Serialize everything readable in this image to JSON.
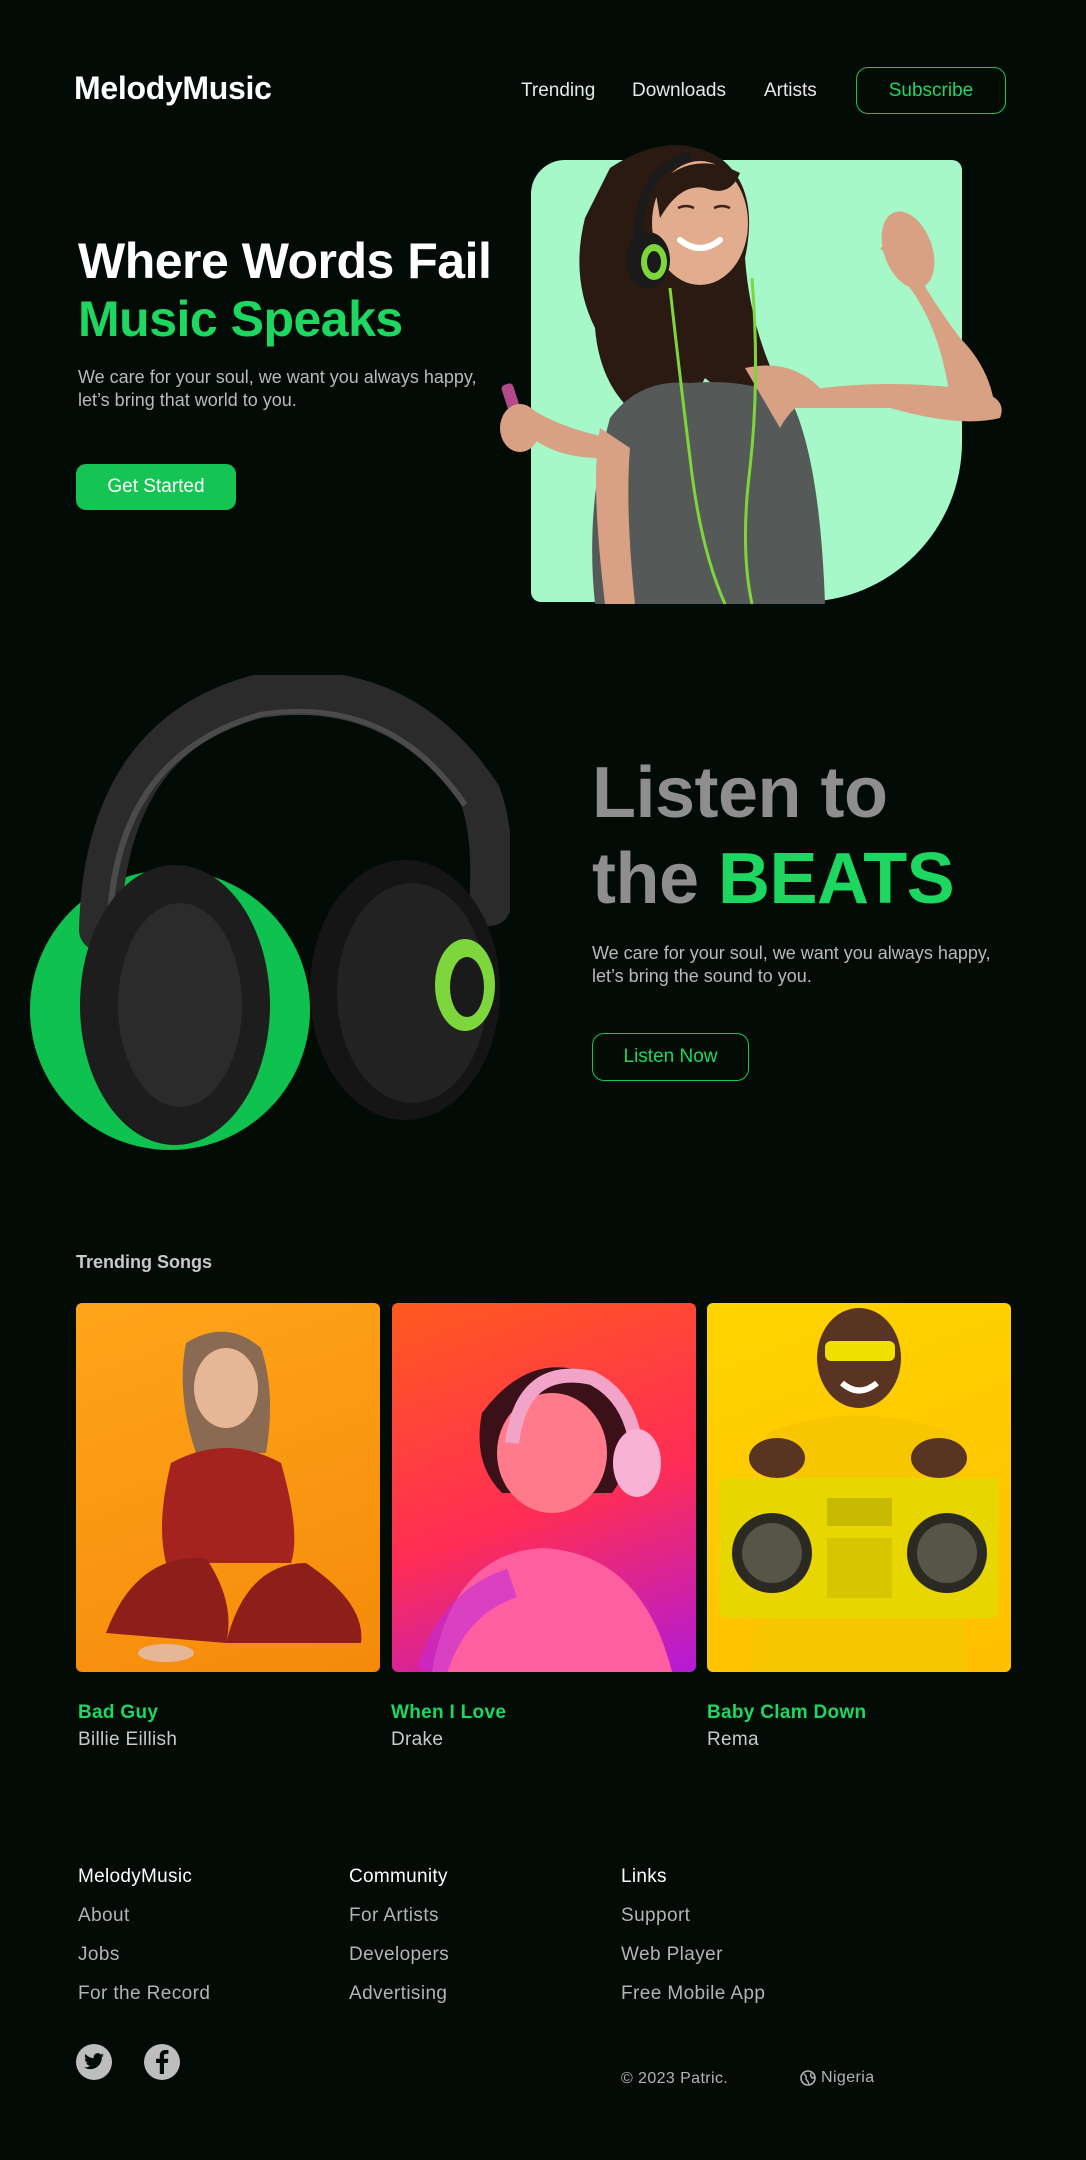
{
  "brand": "MelodyMusic",
  "nav": {
    "links": [
      "Trending",
      "Downloads",
      "Artists"
    ],
    "subscribe": "Subscribe"
  },
  "hero": {
    "title_line1": "Where Words Fail",
    "title_line2": "Music Speaks",
    "subtitle": "We care for your soul, we want you always happy, let’s bring that world to you.",
    "cta": "Get Started"
  },
  "beats": {
    "title_line1": "Listen to",
    "title_line2_plain": "the ",
    "title_line2_accent": "BEATS",
    "subtitle": "We care for your soul, we want you always happy, let’s bring the sound to you.",
    "cta": "Listen Now"
  },
  "trending": {
    "heading": "Trending Songs",
    "songs": [
      {
        "title": "Bad Guy",
        "artist": "Billie Eillish"
      },
      {
        "title": "When I Love",
        "artist": "Drake"
      },
      {
        "title": "Baby Clam Down",
        "artist": "Rema"
      }
    ]
  },
  "footer": {
    "columns": [
      {
        "heading": "MelodyMusic",
        "links": [
          "About",
          "Jobs",
          "For the Record"
        ]
      },
      {
        "heading": "Community",
        "links": [
          "For Artists",
          "Developers",
          "Advertising"
        ]
      },
      {
        "heading": "Links",
        "links": [
          "Support",
          "Web Player",
          "Free Mobile App"
        ]
      }
    ],
    "social_icons": [
      "twitter-icon",
      "facebook-icon"
    ],
    "copyright": "© 2023 Patric.",
    "region": "Nigeria"
  },
  "colors": {
    "background": "#030b07",
    "accent": "#1ed760",
    "hero_panel": "#a6f8c9"
  }
}
